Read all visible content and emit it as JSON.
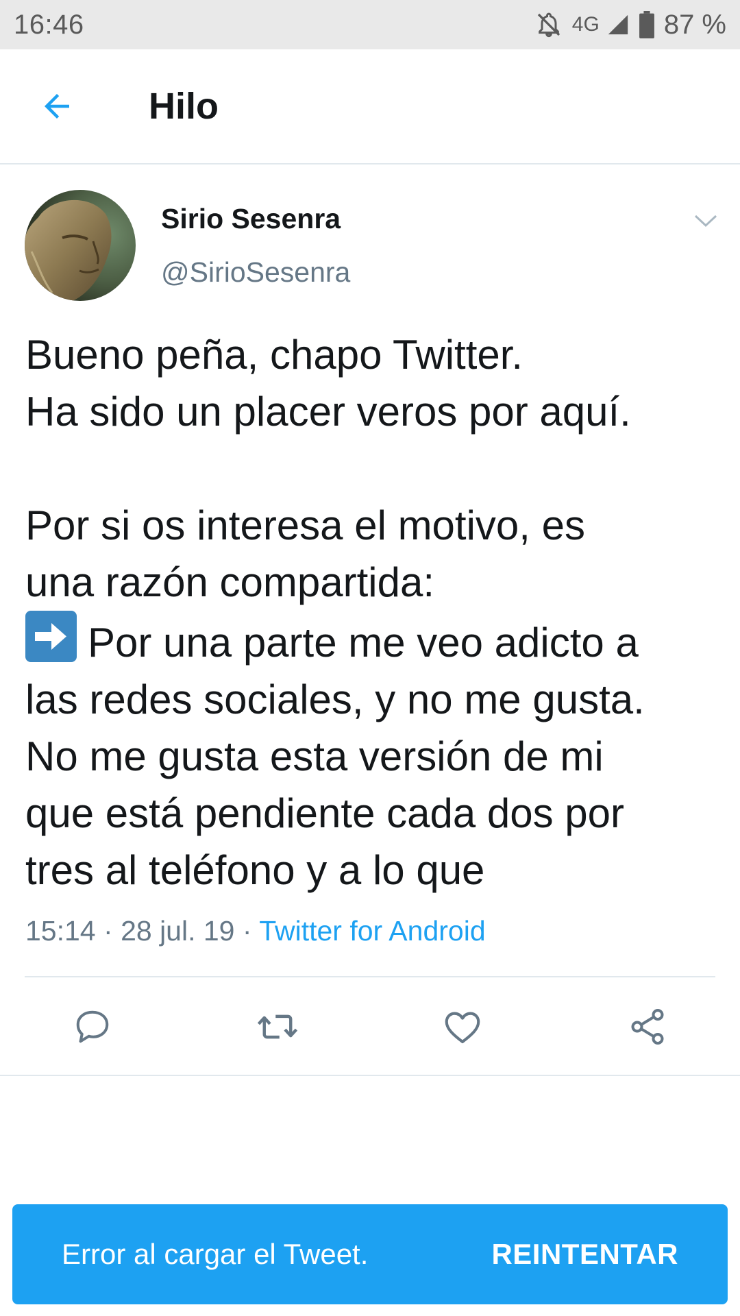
{
  "status_bar": {
    "time": "16:46",
    "network": "4G",
    "battery": "87 %",
    "icons": [
      "notifications-off-icon",
      "signal-icon",
      "battery-icon"
    ]
  },
  "header": {
    "title": "Hilo",
    "back_icon": "arrow-left-icon"
  },
  "tweet": {
    "author_name": "Sirio Sesenra",
    "author_handle": "@SirioSesenra",
    "text_lines": [
      "Bueno peña, chapo Twitter.",
      "Ha sido un placer veros por aquí.",
      "",
      "Por si os interesa el motivo, es",
      "una razón compartida:",
      "Por una parte me veo adicto a",
      "las redes sociales, y no me gusta.",
      "No me gusta esta versión de mi",
      "que está pendiente cada dos por",
      "tres al teléfono y a lo que"
    ],
    "emoji": "right-arrow-emoji",
    "time": "15:14",
    "date": "28 jul. 19",
    "source": "Twitter for Android",
    "separator": "·"
  },
  "actions": [
    "reply-icon",
    "retweet-icon",
    "like-icon",
    "share-icon"
  ],
  "snackbar": {
    "message": "Error al cargar el Tweet.",
    "action": "REINTENTAR"
  },
  "colors": {
    "accent": "#1da1f2",
    "text_primary": "#14171a",
    "text_secondary": "#657786",
    "divider": "#e1e8ed",
    "status_bar_bg": "#e9e9e9",
    "emoji_blue": "#3b88c3"
  }
}
